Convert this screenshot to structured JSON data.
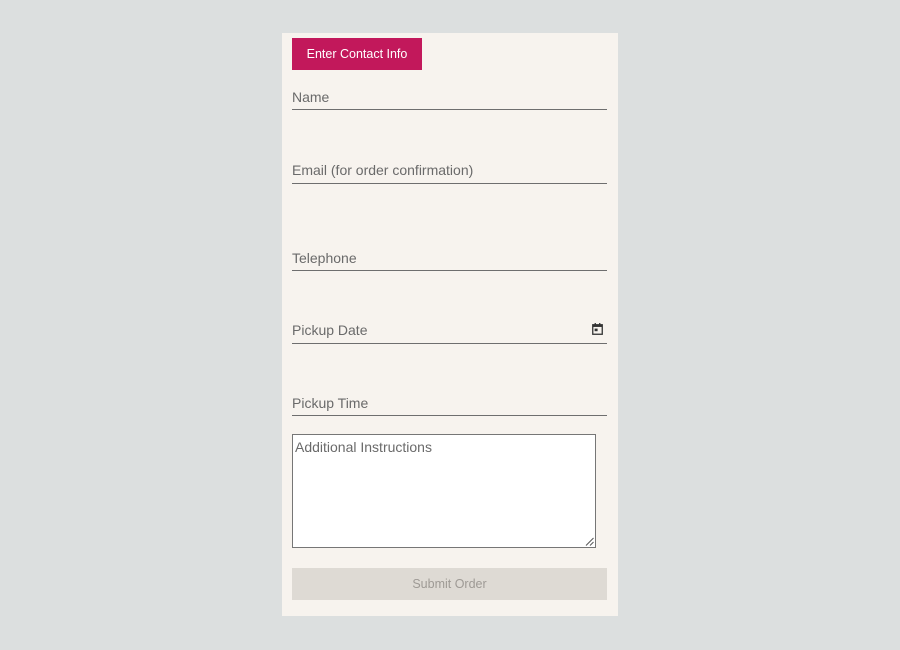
{
  "form": {
    "header_button_label": "Enter Contact Info",
    "fields": {
      "name": {
        "placeholder": "Name",
        "value": ""
      },
      "email": {
        "placeholder": "Email (for order confirmation)",
        "value": ""
      },
      "telephone": {
        "placeholder": "Telephone",
        "value": ""
      },
      "pickup_date": {
        "placeholder": "Pickup Date",
        "value": "",
        "icon": "calendar-icon"
      },
      "pickup_time": {
        "placeholder": "Pickup Time",
        "value": ""
      },
      "instructions": {
        "placeholder": "Additional Instructions",
        "value": ""
      }
    },
    "submit_label": "Submit Order",
    "submit_disabled": true
  },
  "colors": {
    "background": "#dcdfdf",
    "card": "#f7f3ee",
    "accent": "#c2185b",
    "disabled_button": "#dedad4",
    "disabled_text": "#9e9a95"
  }
}
